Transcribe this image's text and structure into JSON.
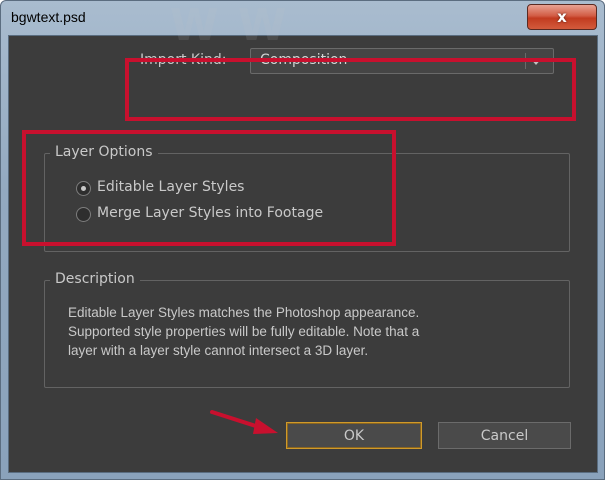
{
  "window": {
    "title": "bgwtext.psd",
    "close_glyph": "x"
  },
  "import": {
    "label": "Import Kind:",
    "selected": "Composition"
  },
  "layer_options": {
    "title": "Layer Options",
    "options": [
      {
        "label": "Editable Layer Styles",
        "checked": true
      },
      {
        "label": "Merge Layer Styles into Footage",
        "checked": false
      }
    ]
  },
  "description": {
    "title": "Description",
    "lines": [
      "Editable Layer Styles matches the Photoshop appearance.",
      "Supported style properties will be fully editable. Note that a",
      "layer with a layer style cannot intersect a 3D layer."
    ]
  },
  "buttons": {
    "ok": "OK",
    "cancel": "Cancel"
  },
  "colors": {
    "panel_bg": "#3c3c3c",
    "annotation_red": "#c8102e",
    "ok_focus": "#d09a2a"
  }
}
